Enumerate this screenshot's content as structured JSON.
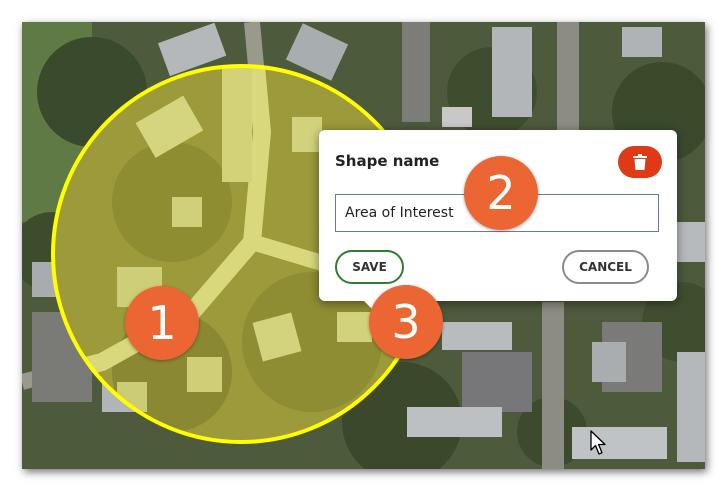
{
  "popup": {
    "title": "Shape name",
    "input_value": "Area of Interest",
    "save_label": "SAVE",
    "cancel_label": "CANCEL",
    "delete_icon": "trash-icon"
  },
  "callouts": [
    "1",
    "2",
    "3"
  ],
  "colors": {
    "highlight_circle_fill": "#e8e23c",
    "highlight_circle_stroke": "#ffff00",
    "delete_button": "#de3a16",
    "save_border": "#2e7d32",
    "callout_badge": "#ec6634",
    "input_border": "#6c74b8"
  }
}
